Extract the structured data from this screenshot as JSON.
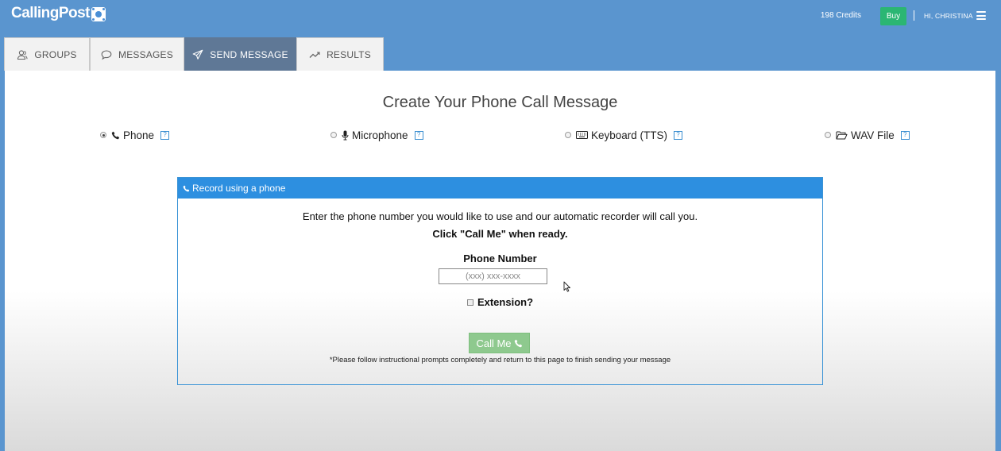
{
  "app": {
    "logo_text": "CallingPost",
    "credits_text": "198 Credits",
    "buy_label": "Buy",
    "greeting": "HI, CHRISTINA",
    "menu_icon": "hamburger-icon"
  },
  "tabs": [
    {
      "label": "GROUPS",
      "icon": "groups-icon",
      "active": false
    },
    {
      "label": "MESSAGES",
      "icon": "speech-bubble-icon",
      "active": false
    },
    {
      "label": "SEND MESSAGE",
      "icon": "paper-plane-icon",
      "active": true
    },
    {
      "label": "RESULTS",
      "icon": "trend-line-icon",
      "active": false
    }
  ],
  "main": {
    "heading": "Create Your Phone Call Message",
    "options": [
      {
        "label": "Phone",
        "icon": "phone-icon",
        "selected": true,
        "help": "?"
      },
      {
        "label": "Microphone",
        "icon": "microphone-icon",
        "selected": false,
        "help": "?"
      },
      {
        "label": "Keyboard (TTS)",
        "icon": "keyboard-icon",
        "selected": false,
        "help": "?"
      },
      {
        "label": "WAV File",
        "icon": "folder-icon",
        "selected": false,
        "help": "?"
      }
    ]
  },
  "record_panel": {
    "title": "Record using a phone",
    "instruction_line1": "Enter the phone number you would like to use and our automatic recorder will call you.",
    "instruction_line2": "Click \"Call Me\" when ready.",
    "phone_label": "Phone Number",
    "phone_value": "",
    "phone_placeholder": "(xxx) xxx-xxxx",
    "extension_label": "Extension?",
    "extension_checked": false,
    "call_button_label": "Call Me",
    "note": "*Please follow instructional prompts completely and return to this page to finish sending your message"
  },
  "colors": {
    "header_bg": "#5a95cf",
    "active_tab": "#5f7896",
    "panel_header": "#2d8fe0",
    "buy_button": "#2bb673",
    "call_button": "#8ec98e"
  }
}
